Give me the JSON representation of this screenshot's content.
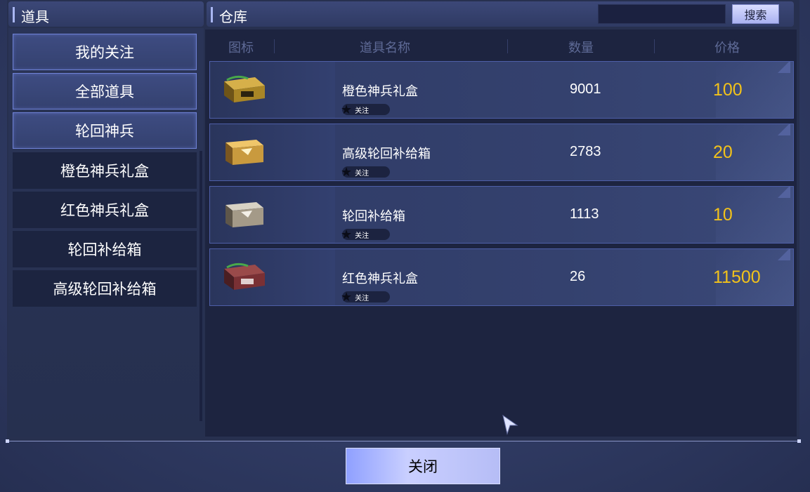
{
  "left": {
    "title": "道具",
    "categories": [
      "我的关注",
      "全部道具",
      "轮回神兵"
    ],
    "subcategories": [
      "橙色神兵礼盒",
      "红色神兵礼盒",
      "轮回补给箱",
      "高级轮回补给箱"
    ]
  },
  "right": {
    "title": "仓库",
    "search_placeholder": "",
    "search_button": "搜索",
    "columns": [
      "图标",
      "道具名称",
      "数量",
      "价格"
    ],
    "items": [
      {
        "name": "橙色神兵礼盒",
        "fav": "关注",
        "qty": "9001",
        "price": "100",
        "icon": "orange-chest-icon"
      },
      {
        "name": "高级轮回补给箱",
        "fav": "关注",
        "qty": "2783",
        "price": "20",
        "icon": "gold-chest-icon"
      },
      {
        "name": "轮回补给箱",
        "fav": "关注",
        "qty": "1113",
        "price": "10",
        "icon": "silver-chest-icon"
      },
      {
        "name": "红色神兵礼盒",
        "fav": "关注",
        "qty": "26",
        "price": "11500",
        "icon": "red-chest-icon"
      }
    ]
  },
  "close_button": "关闭",
  "colors": {
    "price": "#f2c21a",
    "accent": "#6f82d6"
  }
}
